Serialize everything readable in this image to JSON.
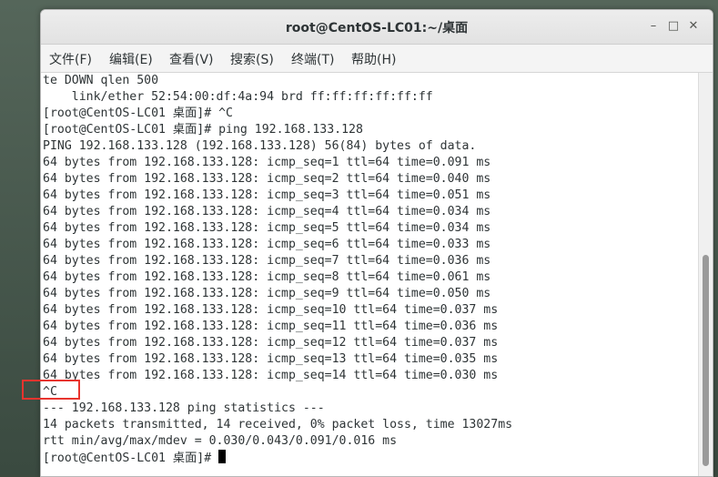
{
  "window": {
    "title": "root@CentOS-LC01:~/桌面",
    "controls": {
      "minimize": "–",
      "maximize": "□",
      "close": "✕"
    }
  },
  "menubar": {
    "items": [
      {
        "label": "文件(F)"
      },
      {
        "label": "编辑(E)"
      },
      {
        "label": "查看(V)"
      },
      {
        "label": "搜索(S)"
      },
      {
        "label": "终端(T)"
      },
      {
        "label": "帮助(H)"
      }
    ]
  },
  "terminal": {
    "lines": [
      "te DOWN qlen 500",
      "    link/ether 52:54:00:df:4a:94 brd ff:ff:ff:ff:ff:ff",
      "[root@CentOS-LC01 桌面]# ^C",
      "[root@CentOS-LC01 桌面]# ping 192.168.133.128",
      "PING 192.168.133.128 (192.168.133.128) 56(84) bytes of data.",
      "64 bytes from 192.168.133.128: icmp_seq=1 ttl=64 time=0.091 ms",
      "64 bytes from 192.168.133.128: icmp_seq=2 ttl=64 time=0.040 ms",
      "64 bytes from 192.168.133.128: icmp_seq=3 ttl=64 time=0.051 ms",
      "64 bytes from 192.168.133.128: icmp_seq=4 ttl=64 time=0.034 ms",
      "64 bytes from 192.168.133.128: icmp_seq=5 ttl=64 time=0.034 ms",
      "64 bytes from 192.168.133.128: icmp_seq=6 ttl=64 time=0.033 ms",
      "64 bytes from 192.168.133.128: icmp_seq=7 ttl=64 time=0.036 ms",
      "64 bytes from 192.168.133.128: icmp_seq=8 ttl=64 time=0.061 ms",
      "64 bytes from 192.168.133.128: icmp_seq=9 ttl=64 time=0.050 ms",
      "64 bytes from 192.168.133.128: icmp_seq=10 ttl=64 time=0.037 ms",
      "64 bytes from 192.168.133.128: icmp_seq=11 ttl=64 time=0.036 ms",
      "64 bytes from 192.168.133.128: icmp_seq=12 ttl=64 time=0.037 ms",
      "64 bytes from 192.168.133.128: icmp_seq=13 ttl=64 time=0.035 ms",
      "64 bytes from 192.168.133.128: icmp_seq=14 ttl=64 time=0.030 ms",
      "^C",
      "--- 192.168.133.128 ping statistics ---",
      "14 packets transmitted, 14 received, 0% packet loss, time 13027ms",
      "rtt min/avg/max/mdev = 0.030/0.043/0.091/0.016 ms",
      "[root@CentOS-LC01 桌面]# "
    ]
  },
  "highlight_color": "#e8342e"
}
